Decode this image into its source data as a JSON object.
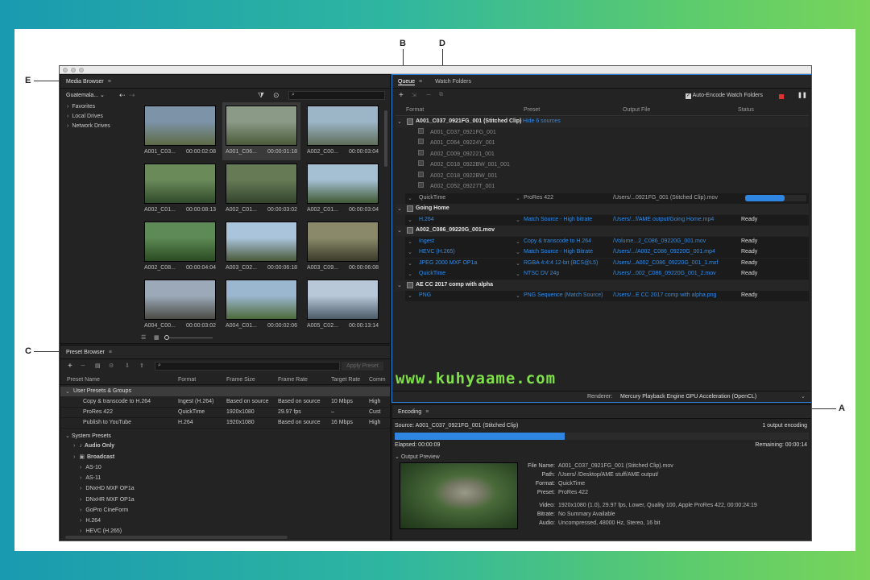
{
  "callouts": {
    "a": "A",
    "b": "B",
    "c": "C",
    "d": "D",
    "e": "E"
  },
  "media_browser": {
    "title": "Media Browser",
    "location": "Guatemala...",
    "tree": [
      "Favorites",
      "Local Drives",
      "Network Drives"
    ],
    "thumbs": [
      {
        "name": "A001_C03...",
        "dur": "00:00:02:08",
        "c1": "#7d93a7",
        "c2": "#5d6a45"
      },
      {
        "name": "A001_C06...",
        "dur": "00:00:01:18",
        "c1": "#8a9a86",
        "c2": "#4a5a3a"
      },
      {
        "name": "A002_C00...",
        "dur": "00:00:03:04",
        "c1": "#9cb5c7",
        "c2": "#5f6d59"
      },
      {
        "name": "A002_C01...",
        "dur": "00:00:08:13",
        "c1": "#6a8a5a",
        "c2": "#2f4a2a"
      },
      {
        "name": "A002_C01...",
        "dur": "00:00:03:02",
        "c1": "#667a56",
        "c2": "#34442c"
      },
      {
        "name": "A002_C01...",
        "dur": "00:00:03:04",
        "c1": "#a5bfd3",
        "c2": "#3f5a33"
      },
      {
        "name": "A002_C08...",
        "dur": "00:00:04:04",
        "c1": "#5d8a56",
        "c2": "#2a4a22"
      },
      {
        "name": "A003_C02...",
        "dur": "00:00:06:18",
        "c1": "#aac4dc",
        "c2": "#4a5a3a"
      },
      {
        "name": "A003_C09...",
        "dur": "00:00:06:08",
        "c1": "#8a8a6a",
        "c2": "#3a3a2a"
      },
      {
        "name": "A004_C00...",
        "dur": "00:00:03:02",
        "c1": "#9ba9b8",
        "c2": "#4a4a44"
      },
      {
        "name": "A004_C01...",
        "dur": "00:00:02:06",
        "c1": "#9bb6cf",
        "c2": "#4c6a3a"
      },
      {
        "name": "A005_C02...",
        "dur": "00:00:13:14",
        "c1": "#b8c8d8",
        "c2": "#4a5a66"
      }
    ]
  },
  "queue": {
    "tab_queue": "Queue",
    "tab_watch": "Watch Folders",
    "auto_encode": "Auto-Encode Watch Folders",
    "col_format": "Format",
    "col_preset": "Preset",
    "col_output": "Output File",
    "col_status": "Status",
    "group1": {
      "name": "A001_C037_0921FG_001 (Stitched Clip)",
      "link": "Hide 6 sources",
      "sources": [
        "A001_C037_0921FG_001",
        "A001_C064_09224Y_001",
        "A002_C009_092221_001",
        "A002_C018_0922BW_001_001",
        "A002_C018_0922BW_001",
        "A002_C052_09227T_001"
      ],
      "item": {
        "format": "QuickTime",
        "preset": "ProRes 422",
        "output": "/Users/...0921FG_001 (Stitched Clip).mov",
        "progress": 0.65
      }
    },
    "group2": {
      "name": "Going Home",
      "item": {
        "format": "H.264",
        "preset": "Match Source - High bitrate",
        "output": "/Users/...f/AME output/Going Home.mp4",
        "status": "Ready"
      }
    },
    "group3": {
      "name": "A002_C086_09220G_001.mov",
      "items": [
        {
          "format": "Ingest",
          "preset": "Copy & transcode to H.264",
          "output": "/Volume...2_C086_09220G_001.mov",
          "status": "Ready"
        },
        {
          "format": "HEVC (H.265)",
          "preset": "Match Source - High Bitrate",
          "output": "/Users/.../A002_C086_09220G_001.mp4",
          "status": "Ready"
        },
        {
          "format": "JPEG 2000 MXF OP1a",
          "preset": "RGBA 4:4:4 12-bit (BCS@L5)",
          "output": "/Users/...A002_C086_09220G_001_1.mxf",
          "status": "Ready"
        },
        {
          "format": "QuickTime",
          "preset": "NTSC DV 24p",
          "output": "/Users/...002_C086_09220G_001_2.mov",
          "status": "Ready"
        }
      ]
    },
    "group4": {
      "name": "AE CC 2017 comp with alpha",
      "item": {
        "format": "PNG",
        "preset": "PNG Sequence (Match Source)",
        "output": "/Users/...E CC 2017 comp with alpha.png",
        "status": "Ready"
      }
    },
    "watermark": "www.kuhyaame.com",
    "renderer_label": "Renderer:",
    "renderer_value": "Mercury Playback Engine GPU Acceleration (OpenCL)"
  },
  "preset_browser": {
    "title": "Preset Browser",
    "apply": "Apply Preset",
    "cols": [
      "Preset Name",
      "Format",
      "Frame Size",
      "Frame Rate",
      "Target Rate",
      "Comm"
    ],
    "user_group": "User Presets & Groups",
    "user_rows": [
      [
        "Copy & transcode to H.264",
        "Ingest (H.264)",
        "Based on source",
        "Based on source",
        "10 Mbps",
        "High"
      ],
      [
        "ProRes 422",
        "QuickTime",
        "1920x1080",
        "29.97 fps",
        "–",
        "Cust"
      ],
      [
        "Publish to YouTube",
        "H.264",
        "1920x1080",
        "Based on source",
        "16 Mbps",
        "High"
      ]
    ],
    "system_group": "System Presets",
    "system_items": [
      "Audio Only",
      "Broadcast",
      "AS-10",
      "AS-11",
      "DNxHD MXF OP1a",
      "DNxHR MXF OP1a",
      "GoPro CineForm",
      "H.264",
      "HEVC (H.265)"
    ]
  },
  "encoding": {
    "title": "Encoding",
    "source": "Source: A001_C037_0921FG_001 (Stitched Clip)",
    "count": "1 output encoding",
    "elapsed": "Elapsed: 00:00:09",
    "remaining": "Remaining: 00:00:14",
    "progress": 0.41,
    "preview_label": "Output Preview",
    "info": [
      [
        "File Name:",
        "A001_C037_0921FG_001 (Stitched Clip).mov"
      ],
      [
        "Path:",
        "/Users/        /Desktop/AME stuff/AME output/"
      ],
      [
        "Format:",
        "QuickTime"
      ],
      [
        "Preset:",
        "ProRes 422"
      ],
      [
        "Video:",
        "1920x1080 (1.0), 29.97 fps, Lower, Quality 100, Apple ProRes 422, 00:00:24:19"
      ],
      [
        "Bitrate:",
        "No Summary Available"
      ],
      [
        "Audio:",
        "Uncompressed, 48000 Hz, Stereo, 16 bit"
      ]
    ]
  }
}
